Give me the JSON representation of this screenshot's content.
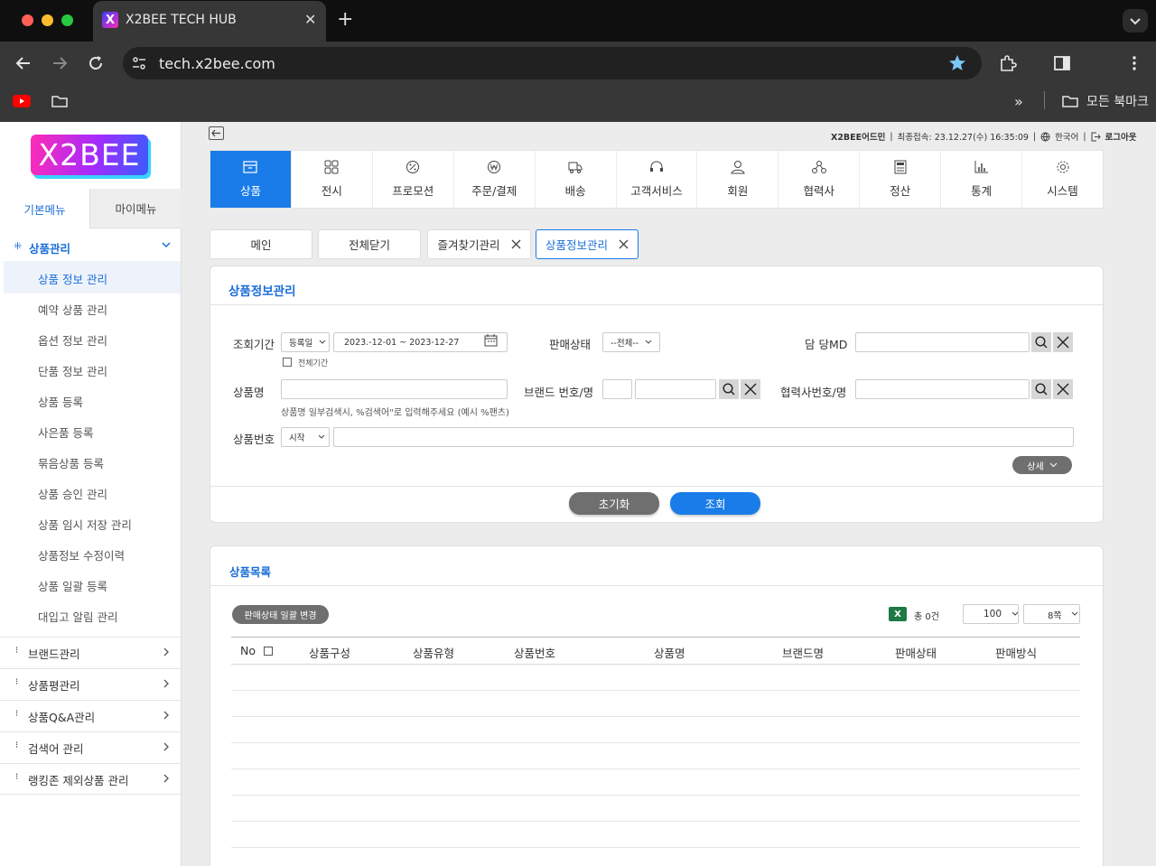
{
  "browser": {
    "tab_title": "X2BEE TECH HUB",
    "url": "tech.x2bee.com",
    "all_bookmarks": "모든 북마크"
  },
  "logo": {
    "text": "X2BEE"
  },
  "sidebar": {
    "tabs": [
      "기본메뉴",
      "마이메뉴"
    ],
    "group": "상품관리",
    "items": [
      "상품 정보 관리",
      "예약 상품 관리",
      "옵션 정보 관리",
      "단품 정보 관리",
      "상품 등록",
      "사은품 등록",
      "묶음상품 등록",
      "상품 승인 관리",
      "상품 임시 저장 관리",
      "상품정보 수정이력",
      "상품 일괄 등록",
      "대입고 알림 관리"
    ],
    "categories": [
      "브랜드관리",
      "상품평관리",
      "상품Q&A관리",
      "검색어 관리",
      "랭킹존 제외상품 관리"
    ]
  },
  "header": {
    "admin": "X2BEE어드민",
    "last_login": "최종접속: 23.12.27(수) 16:35:09",
    "language": "한국어",
    "logout": "로그아웃"
  },
  "nav": [
    {
      "label": "상품",
      "icon": "box-icon"
    },
    {
      "label": "전시",
      "icon": "grid-icon"
    },
    {
      "label": "프로모션",
      "icon": "percent-icon"
    },
    {
      "label": "주문/결제",
      "icon": "won-icon"
    },
    {
      "label": "배송",
      "icon": "truck-icon"
    },
    {
      "label": "고객서비스",
      "icon": "headset-icon"
    },
    {
      "label": "회원",
      "icon": "user-icon"
    },
    {
      "label": "협력사",
      "icon": "partner-icon"
    },
    {
      "label": "정산",
      "icon": "calculator-icon"
    },
    {
      "label": "통계",
      "icon": "chart-icon"
    },
    {
      "label": "시스템",
      "icon": "gear-icon"
    }
  ],
  "page_tabs": [
    "메인",
    "전체닫기",
    "즐겨찾기관리",
    "상품정보관리"
  ],
  "search": {
    "title": "상품정보관리",
    "period_label": "조회기간",
    "period_type": "등록일",
    "date_range": "2023.-12-01 ~ 2023-12-27",
    "all_period": "전체기간",
    "sale_status_label": "판매상태",
    "sale_status_value": "--전체--",
    "md_label": "담 당MD",
    "product_name_label": "상품명",
    "product_name_hint": "상품명 일부검색시, %검색어\"로 입력해주세요 (예시 %팬츠)",
    "brand_label": "브랜드 번호/명",
    "partner_label": "협력사번호/명",
    "product_no_label": "상품번호",
    "product_no_type": "시작",
    "detail_button": "상세",
    "reset_button": "초기화",
    "search_button": "조회"
  },
  "list": {
    "title": "상품목록",
    "bulk_button": "판매상태 일괄 변경",
    "total": "총 0건",
    "page_size": "100",
    "width_option": "8쪽",
    "columns": [
      "No",
      "상품구성",
      "상품유형",
      "상품번호",
      "상품명",
      "브랜드명",
      "판매상태",
      "판매방식"
    ]
  }
}
